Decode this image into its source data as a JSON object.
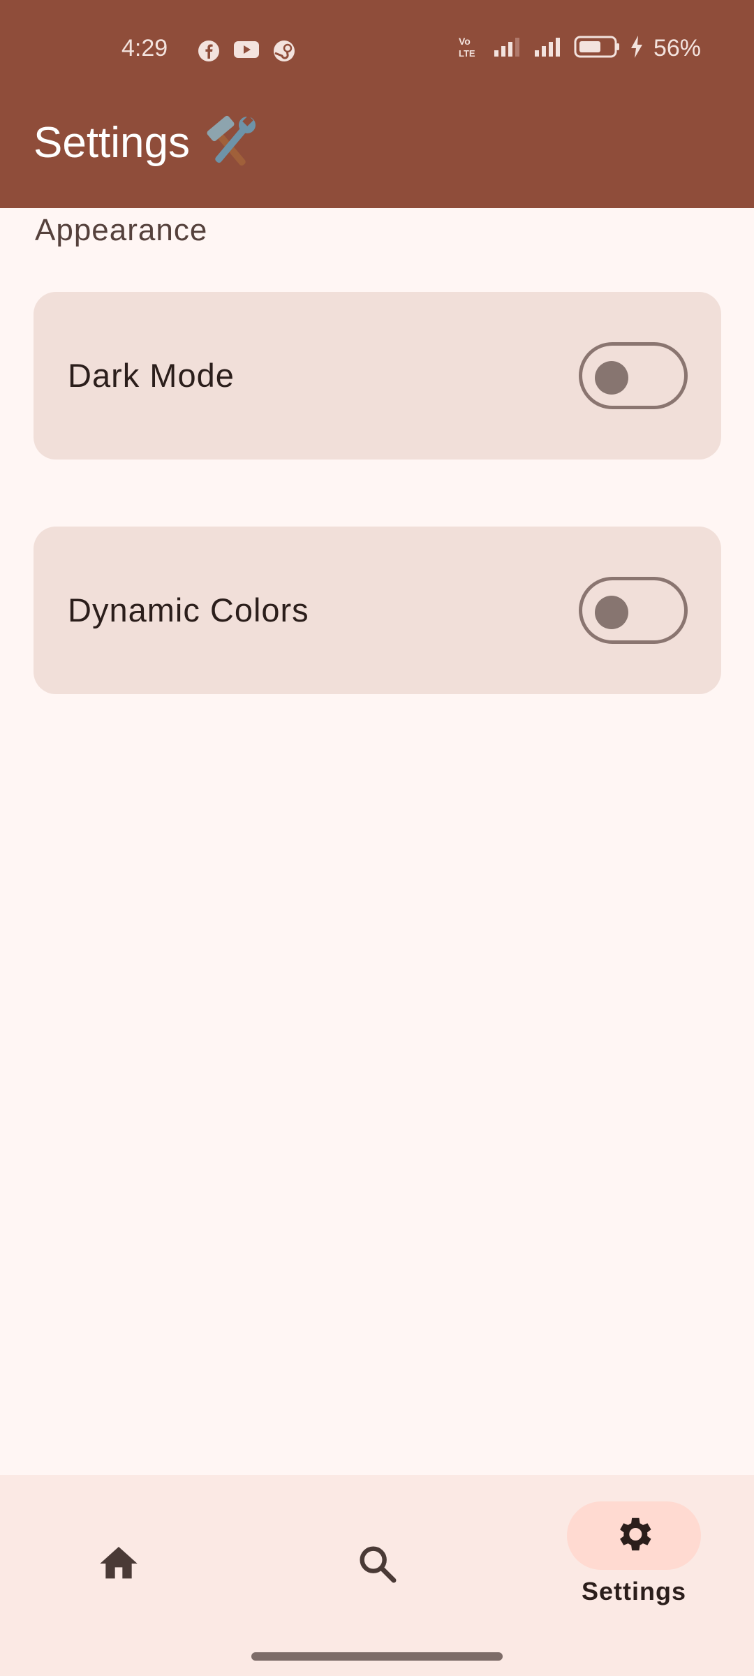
{
  "status_bar": {
    "time": "4:29",
    "battery_percent": "56%",
    "app_icons": [
      "facebook-icon",
      "youtube-icon",
      "steam-icon"
    ],
    "right_icons": [
      "volte-icon",
      "signal-icon",
      "signal-icon",
      "battery-icon",
      "charging-icon"
    ]
  },
  "header": {
    "title": "Settings",
    "title_icon": "hammer-and-wrench-icon",
    "background_color": "#8f4d3a"
  },
  "section": {
    "label": "Appearance"
  },
  "settings": [
    {
      "label": "Dark Mode",
      "enabled": false
    },
    {
      "label": "Dynamic Colors",
      "enabled": false
    }
  ],
  "bottom_nav": {
    "items": [
      {
        "icon": "home-icon",
        "label": "",
        "selected": false
      },
      {
        "icon": "search-icon",
        "label": "",
        "selected": false
      },
      {
        "icon": "settings-icon",
        "label": "Settings",
        "selected": true
      }
    ],
    "selected_indicator_color": "#ffdad1"
  },
  "colors": {
    "background": "#fff6f4",
    "card": "#f1dfd9",
    "text": "#2b1e1b"
  }
}
